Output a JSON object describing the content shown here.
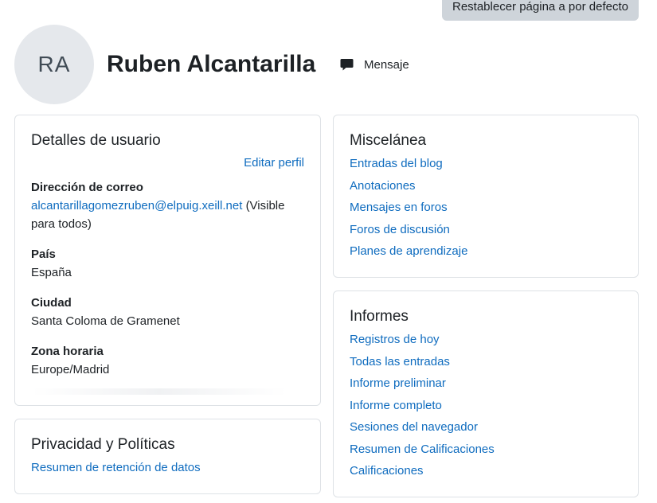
{
  "header": {
    "reset_label": "Restablecer página a por defecto",
    "avatar_initials": "RA",
    "fullname": "Ruben Alcantarilla",
    "message_label": "Mensaje"
  },
  "user_details": {
    "title": "Detalles de usuario",
    "edit_label": "Editar perfil",
    "email_label": "Dirección de correo",
    "email_value": "alcantarillagomezruben@elpuig.xeill.net",
    "email_visibility": "(Visible para todos)",
    "country_label": "País",
    "country_value": "España",
    "city_label": "Ciudad",
    "city_value": "Santa Coloma de Gramenet",
    "timezone_label": "Zona horaria",
    "timezone_value": "Europe/Madrid"
  },
  "privacy": {
    "title": "Privacidad y Políticas",
    "link": "Resumen de retención de datos"
  },
  "misc": {
    "title": "Miscelánea",
    "links": [
      "Entradas del blog",
      "Anotaciones",
      "Mensajes en foros",
      "Foros de discusión",
      "Planes de aprendizaje"
    ]
  },
  "reports": {
    "title": "Informes",
    "links": [
      "Registros de hoy",
      "Todas las entradas",
      "Informe preliminar",
      "Informe completo",
      "Sesiones del navegador",
      "Resumen de Calificaciones",
      "Calificaciones"
    ]
  },
  "colors": {
    "link": "#0f6cbf",
    "text": "#1d2125",
    "button_bg": "#ced4da",
    "avatar_bg": "#e5e8ec",
    "border": "#dee2e6"
  },
  "icons": {
    "message": "speech-bubble-icon"
  }
}
